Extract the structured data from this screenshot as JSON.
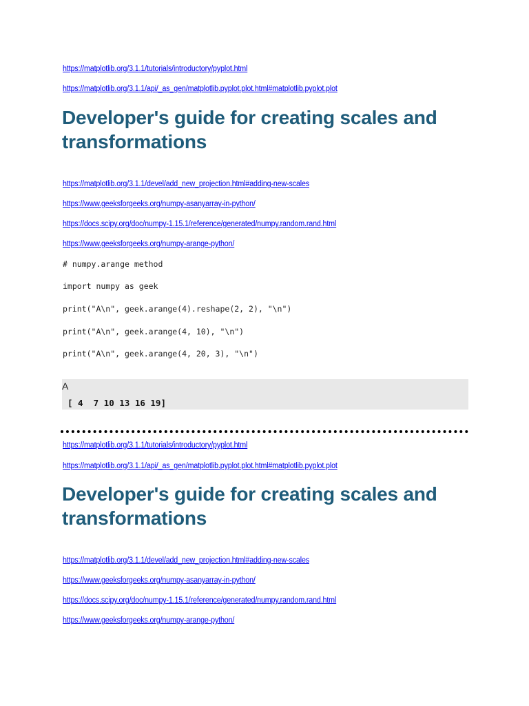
{
  "top_links": [
    "https://matplotlib.org/3.1.1/tutorials/introductory/pyplot.html",
    "https://matplotlib.org/3.1.1/api/_as_gen/matplotlib.pyplot.plot.html#matplotlib.pyplot.plot"
  ],
  "heading": "Developer's guide for creating scales and transformations",
  "ref_links": [
    "https://matplotlib.org/3.1.1/devel/add_new_projection.html#adding-new-scales",
    "https://www.geeksforgeeks.org/numpy-asanyarray-in-python/",
    "https://docs.scipy.org/doc/numpy-1.15.1/reference/generated/numpy.random.rand.html",
    "https://www.geeksforgeeks.org/numpy-arange-python/"
  ],
  "code_lines": [
    "# numpy.arange method",
    "import numpy as geek",
    "print(\"A\\n\", geek.arange(4).reshape(2, 2), \"\\n\")",
    "print(\"A\\n\", geek.arange(4, 10), \"\\n\")",
    "print(\"A\\n\", geek.arange(4, 20, 3), \"\\n\")"
  ],
  "output": {
    "label": "A",
    "value": "[ 4  7 10 13 16 19]"
  },
  "repeat": {
    "top_links": [
      "https://matplotlib.org/3.1.1/tutorials/introductory/pyplot.html",
      "https://matplotlib.org/3.1.1/api/_as_gen/matplotlib.pyplot.plot.html#matplotlib.pyplot.plot"
    ],
    "heading": "Developer's guide for creating scales and transformations",
    "ref_links": [
      "https://matplotlib.org/3.1.1/devel/add_new_projection.html#adding-new-scales",
      "https://www.geeksforgeeks.org/numpy-asanyarray-in-python/",
      "https://docs.scipy.org/doc/numpy-1.15.1/reference/generated/numpy.random.rand.html",
      "https://www.geeksforgeeks.org/numpy-arange-python/"
    ]
  },
  "colors": {
    "link": "#0000ee",
    "heading": "#1f5c7a",
    "output_background": "#e8e8e8"
  }
}
